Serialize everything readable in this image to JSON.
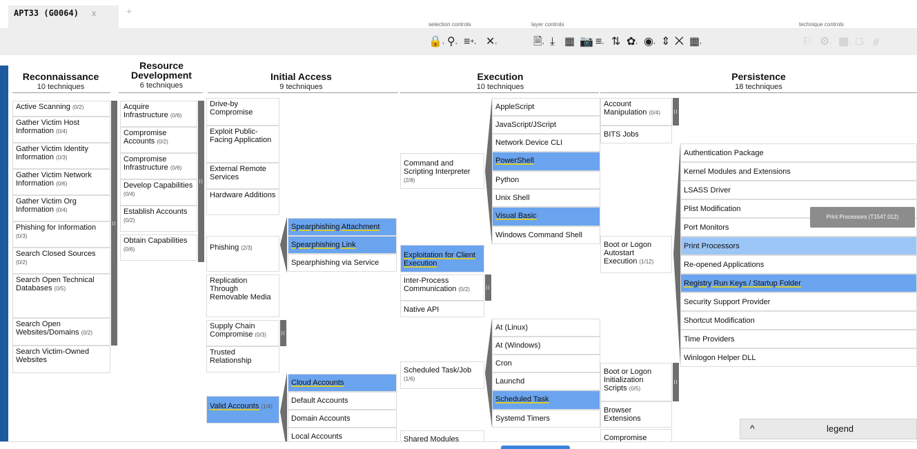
{
  "tabs": [
    {
      "label": "APT33 (G0064)",
      "close": "x"
    }
  ],
  "tab_add": "+",
  "toolbar": {
    "selection_label": "selection controls",
    "layer_label": "layer controls",
    "technique_label": "technique controls"
  },
  "tactics": {
    "reconnaissance": {
      "name": "Reconnaissance",
      "count": "10 techniques"
    },
    "resource_development": {
      "name": "Resource Development",
      "count": "6 techniques"
    },
    "initial_access": {
      "name": "Initial Access",
      "count": "9 techniques"
    },
    "execution": {
      "name": "Execution",
      "count": "10 techniques"
    },
    "persistence": {
      "name": "Persistence",
      "count": "18 techniques"
    }
  },
  "recon": [
    {
      "label": "Active Scanning",
      "sub": "(0/2)"
    },
    {
      "label": "Gather Victim Host Information",
      "sub": "(0/4)"
    },
    {
      "label": "Gather Victim Identity Information",
      "sub": "(0/3)"
    },
    {
      "label": "Gather Victim Network Information",
      "sub": "(0/6)"
    },
    {
      "label": "Gather Victim Org Information",
      "sub": "(0/4)"
    },
    {
      "label": "Phishing for Information",
      "sub": "(0/3)"
    },
    {
      "label": "Search Closed Sources",
      "sub": "(0/2)"
    },
    {
      "label": "Search Open Technical Databases",
      "sub": "(0/5)"
    },
    {
      "label": "Search Open Websites/Domains",
      "sub": "(0/2)"
    },
    {
      "label": "Search Victim-Owned Websites",
      "sub": ""
    }
  ],
  "resdev": [
    {
      "label": "Acquire Infrastructure",
      "sub": "(0/6)"
    },
    {
      "label": "Compromise Accounts",
      "sub": "(0/2)"
    },
    {
      "label": "Compromise Infrastructure",
      "sub": "(0/6)"
    },
    {
      "label": "Develop Capabilities",
      "sub": "(0/4)"
    },
    {
      "label": "Establish Accounts",
      "sub": "(0/2)"
    },
    {
      "label": "Obtain Capabilities",
      "sub": "(0/6)"
    }
  ],
  "initial": [
    {
      "label": "Drive-by Compromise",
      "sub": ""
    },
    {
      "label": "Exploit Public-Facing Application",
      "sub": ""
    },
    {
      "label": "External Remote Services",
      "sub": ""
    },
    {
      "label": "Hardware Additions",
      "sub": ""
    },
    {
      "label": "Phishing",
      "sub": "(2/3)"
    },
    {
      "label": "Replication Through Removable Media",
      "sub": ""
    },
    {
      "label": "Supply Chain Compromise",
      "sub": "(0/3)"
    },
    {
      "label": "Trusted Relationship",
      "sub": ""
    },
    {
      "label": "Valid Accounts",
      "sub": "(1/4)"
    }
  ],
  "phishing_subs": [
    "Spearphishing Attachment",
    "Spearphishing Link",
    "Spearphishing via Service"
  ],
  "valid_subs": [
    "Cloud Accounts",
    "Default Accounts",
    "Domain Accounts",
    "Local Accounts"
  ],
  "execution": [
    {
      "label": "Command and Scripting Interpreter",
      "sub": "(2/8)"
    },
    {
      "label": "Exploitation for Client Execution",
      "sub": ""
    },
    {
      "label": "Inter-Process Communication",
      "sub": "(0/2)"
    },
    {
      "label": "Native API",
      "sub": ""
    },
    {
      "label": "Scheduled Task/Job",
      "sub": "(1/6)"
    },
    {
      "label": "Shared Modules",
      "sub": ""
    }
  ],
  "script_subs": [
    "AppleScript",
    "JavaScript/JScript",
    "Network Device CLI",
    "PowerShell",
    "Python",
    "Unix Shell",
    "Visual Basic",
    "Windows Command Shell"
  ],
  "sched_subs": [
    "At (Linux)",
    "At (Windows)",
    "Cron",
    "Launchd",
    "Scheduled Task",
    "Systemd Timers"
  ],
  "persistence": [
    {
      "label": "Account Manipulation",
      "sub": "(0/4)"
    },
    {
      "label": "BITS Jobs",
      "sub": ""
    },
    {
      "label": "Boot or Logon Autostart Execution",
      "sub": "(1/12)"
    },
    {
      "label": "Boot or Logon Initialization Scripts",
      "sub": "(0/5)"
    },
    {
      "label": "Browser Extensions",
      "sub": ""
    },
    {
      "label": "Compromise",
      "sub": ""
    }
  ],
  "boot_subs": [
    "Authentication Package",
    "Kernel Modules and Extensions",
    "LSASS Driver",
    "Plist Modification",
    "Port Monitors",
    "Print Processors",
    "Re-opened Applications",
    "Registry Run Keys / Startup Folder",
    "Security Support Provider",
    "Shortcut Modification",
    "Time Providers",
    "Winlogon Helper DLL"
  ],
  "tooltip": "Print Processors (T1547.012)",
  "legend": {
    "label": "legend",
    "chevron": "^"
  }
}
